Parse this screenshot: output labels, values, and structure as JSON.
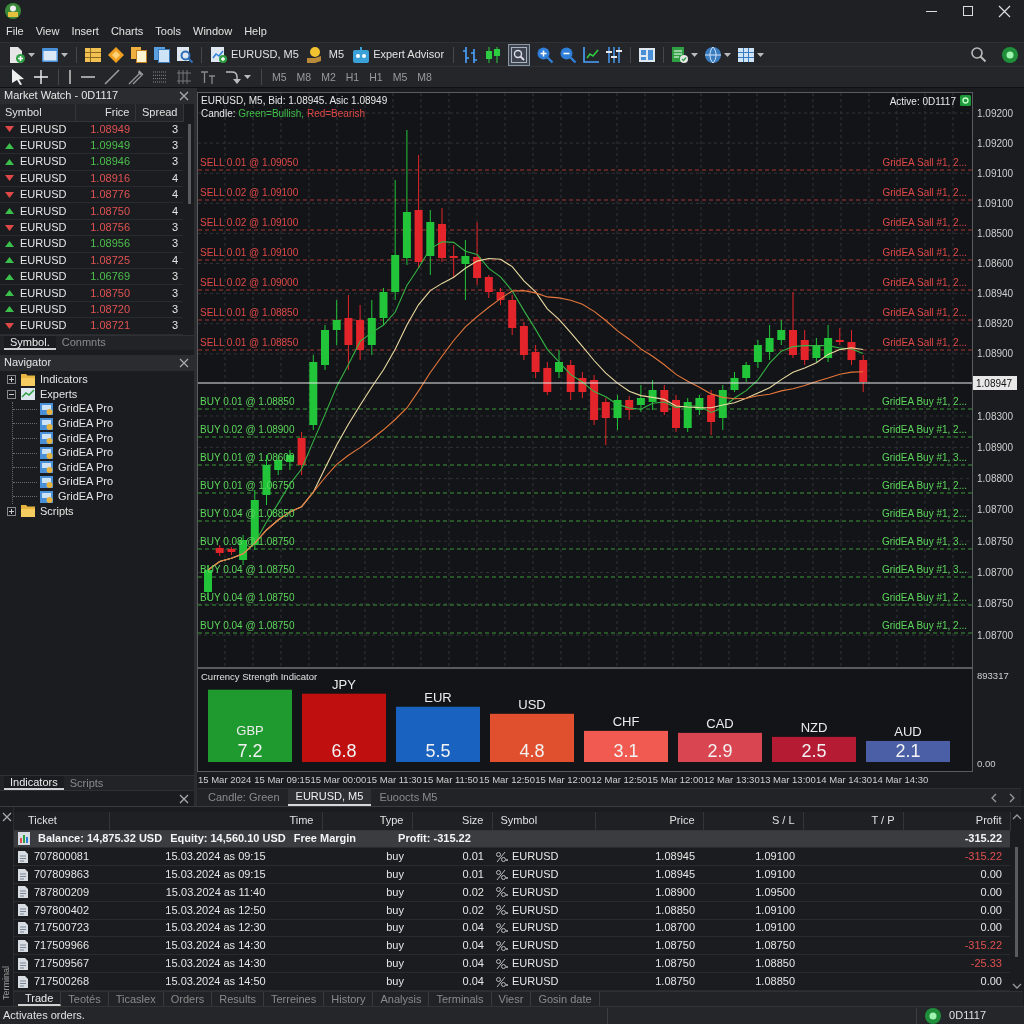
{
  "menu": [
    "File",
    "View",
    "Insert",
    "Charts",
    "Tools",
    "Window",
    "Help"
  ],
  "toolbar": [
    {
      "kind": "icon",
      "dropdown": true,
      "pressed": false
    },
    {
      "kind": "icon",
      "dropdown": true,
      "pressed": false
    },
    {
      "kind": "separator"
    },
    {
      "kind": "icon",
      "dropdown": false,
      "pressed": false
    },
    {
      "kind": "icon",
      "dropdown": false,
      "pressed": false
    },
    {
      "kind": "icon",
      "dropdown": false,
      "pressed": false
    },
    {
      "kind": "icon",
      "dropdown": false,
      "pressed": false
    },
    {
      "kind": "icon",
      "dropdown": false,
      "pressed": false
    },
    {
      "kind": "separator"
    },
    {
      "kind": "labeled",
      "label": "EURUSD, M5",
      "pressed": false
    },
    {
      "kind": "icon",
      "dropdown": false,
      "pressed": false
    },
    {
      "kind": "text",
      "label": "M5",
      "pressed": false
    },
    {
      "kind": "labeled",
      "label": "Expert Advisor",
      "pressed": false
    },
    {
      "kind": "separator"
    },
    {
      "kind": "icon",
      "dropdown": false,
      "pressed": false
    },
    {
      "kind": "icon",
      "dropdown": false,
      "pressed": false
    },
    {
      "kind": "icon",
      "dropdown": false,
      "pressed": true
    },
    {
      "kind": "icon",
      "dropdown": false,
      "pressed": false
    },
    {
      "kind": "icon",
      "dropdown": false,
      "pressed": false
    },
    {
      "kind": "icon",
      "dropdown": false,
      "pressed": false
    },
    {
      "kind": "icon",
      "dropdown": false,
      "pressed": false
    },
    {
      "kind": "separator"
    },
    {
      "kind": "icon",
      "dropdown": false,
      "pressed": false
    },
    {
      "kind": "separator"
    },
    {
      "kind": "icon",
      "dropdown": true,
      "pressed": false
    },
    {
      "kind": "icon",
      "dropdown": true,
      "pressed": false
    },
    {
      "kind": "icon",
      "dropdown": true,
      "pressed": false
    }
  ],
  "drawing_toolbar": [
    {
      "kind": "icon",
      "dropdown": false,
      "pressed": false
    },
    {
      "kind": "icon",
      "dropdown": false,
      "pressed": false
    },
    {
      "kind": "separator"
    },
    {
      "kind": "icon",
      "dropdown": false,
      "pressed": false
    },
    {
      "kind": "icon",
      "dropdown": false,
      "pressed": false
    },
    {
      "kind": "icon",
      "dropdown": false,
      "pressed": false
    },
    {
      "kind": "icon",
      "dropdown": false,
      "pressed": false
    },
    {
      "kind": "icon",
      "dropdown": false,
      "pressed": false
    },
    {
      "kind": "icon",
      "dropdown": false,
      "pressed": false
    },
    {
      "kind": "icon",
      "dropdown": false,
      "pressed": false
    },
    {
      "kind": "icon",
      "dropdown": true,
      "pressed": false
    },
    {
      "kind": "separator"
    },
    {
      "kind": "text",
      "label": "M5",
      "pressed": false
    },
    {
      "kind": "text",
      "label": "M8",
      "pressed": false
    },
    {
      "kind": "text",
      "label": "M2",
      "pressed": false
    },
    {
      "kind": "text",
      "label": "H1",
      "pressed": false
    },
    {
      "kind": "text",
      "label": "H1",
      "pressed": false
    },
    {
      "kind": "text",
      "label": "M5",
      "pressed": false
    },
    {
      "kind": "text",
      "label": "M8",
      "pressed": false
    }
  ],
  "market_watch": {
    "title": "Market Watch - 0D1117",
    "columns": [
      "Symbol",
      "Frice",
      "Spread"
    ],
    "rows": [
      {
        "kind": "down",
        "symbol": "EURUSD",
        "price": "1.08949",
        "color": "#e05252",
        "spread": "3"
      },
      {
        "kind": "up",
        "symbol": "EURUSD",
        "price": "1.09949",
        "color": "#4cbf4c",
        "spread": "3"
      },
      {
        "kind": "up",
        "symbol": "EURUSD",
        "price": "1.08946",
        "color": "#4cbf4c",
        "spread": "3"
      },
      {
        "kind": "down",
        "symbol": "EURUSD",
        "price": "1.08916",
        "color": "#e05252",
        "spread": "4"
      },
      {
        "kind": "down",
        "symbol": "EURUSD",
        "price": "1.08776",
        "color": "#e05252",
        "spread": "4"
      },
      {
        "kind": "up",
        "symbol": "EURUSD",
        "price": "1.08750",
        "color": "#e05252",
        "spread": "4"
      },
      {
        "kind": "down",
        "symbol": "EURUSD",
        "price": "1.08756",
        "color": "#e05252",
        "spread": "3"
      },
      {
        "kind": "up",
        "symbol": "EURUSD",
        "price": "1.08956",
        "color": "#4cbf4c",
        "spread": "3"
      },
      {
        "kind": "up",
        "symbol": "EURUSD",
        "price": "1.08725",
        "color": "#e05252",
        "spread": "4"
      },
      {
        "kind": "up",
        "symbol": "EURUSD",
        "price": "1.06769",
        "color": "#4cbf4c",
        "spread": "3"
      },
      {
        "kind": "up",
        "symbol": "EURUSD",
        "price": "1.08750",
        "color": "#e05252",
        "spread": "3"
      },
      {
        "kind": "up",
        "symbol": "EURUSD",
        "price": "1.08720",
        "color": "#e05252",
        "spread": "3"
      },
      {
        "kind": "down",
        "symbol": "EURUSD",
        "price": "1.08721",
        "color": "#e05252",
        "spread": "3"
      }
    ],
    "tabs": [
      {
        "label": "Symbol.",
        "selected": true
      },
      {
        "label": "Conmnts",
        "selected": false
      }
    ]
  },
  "navigator": {
    "title": "Navigator",
    "tree": [
      {
        "label": "Indicators",
        "kind": "folder",
        "expanded": false
      },
      {
        "label": "Experts",
        "kind": "experts",
        "expanded": true,
        "children": [
          {
            "label": "GridEA Pro"
          },
          {
            "label": "GridEA Pro"
          },
          {
            "label": "GridEA Pro"
          },
          {
            "label": "GridEA Pro"
          },
          {
            "label": "GridEA Pro"
          },
          {
            "label": "GridEA Pro"
          },
          {
            "label": "GridEA Pro"
          }
        ]
      },
      {
        "label": "Scripts",
        "kind": "folder",
        "expanded": false
      }
    ],
    "tabs": [
      {
        "label": "Indicators",
        "selected": true
      },
      {
        "label": "Scripts",
        "selected": false
      }
    ]
  },
  "chart": {
    "info": "EURUSD, M5, Bid: 1.08945. Asic 1.08949",
    "legend": {
      "label": "Candle:",
      "items": [
        {
          "text": "Green=Bullish,",
          "color": "#3fbf4a"
        },
        {
          "text": "Red=Bearish",
          "color": "#e04848"
        }
      ]
    },
    "account": "Active: 0D1117",
    "sell_orders": [
      {
        "label": "SELL 0.01 @ 1.09050",
        "comment": "GridEA Sall #1, 2..."
      },
      {
        "label": "SELL 0.02 @ 1.09100",
        "comment": "GridEA Sall #1, 2..."
      },
      {
        "label": "SELL 0.02 @ 1.09100",
        "comment": "GridEA Sall #1, 2..."
      },
      {
        "label": "SELL 0.01 @ 1.09100",
        "comment": "GridEA Sall #1, 2..."
      },
      {
        "label": "SELL 0.02 @ 1.09000",
        "comment": "GridEA Sall #1, 2..."
      },
      {
        "label": "SELL 0.01 @ 1.08850",
        "comment": "GridEA Sall #1, 2..."
      },
      {
        "label": "SELL 0.01 @ 1.08850",
        "comment": "GridEA Sall #1, 2..."
      }
    ],
    "buy_orders": [
      {
        "label": "BUY 0.01 @ 1.08850",
        "comment": "GridEA Buy #1, 2..."
      },
      {
        "label": "BUY 0.02 @ 1.08900",
        "comment": "GridEA Buy #1, 2..."
      },
      {
        "label": "BUY 0.01 @ 1.08600",
        "comment": "GridEA Buy #1, 3..."
      },
      {
        "label": "BUY 0.01 @ 1.06750",
        "comment": "GridEA Buy #1, 2..."
      },
      {
        "label": "BUY 0.04 @ 1.08850",
        "comment": "GridEA Buy #1, 2..."
      },
      {
        "label": "BUY 0.08 @ 1.08750",
        "comment": "GridEA Buy #1, 3..."
      },
      {
        "label": "BUY 0.04 @ 1.08750",
        "comment": "GridEA Buy #1, 3..."
      },
      {
        "label": "BUY 0.04 @ 1.08750",
        "comment": "GridEA Buy #1, 2..."
      },
      {
        "label": "BUY 0.04 @ 1.08750",
        "comment": "GridEA Buy #1, 2..."
      }
    ],
    "price_axis": [
      "1.09200",
      "1.09200",
      "1.09100",
      "1.09100",
      "1.08500",
      "1.08600",
      "1.08940",
      "1.08920",
      "1.08900",
      "1.08300",
      "1.08900",
      "1.08800",
      "1.08700",
      "1.08750",
      "1.08700",
      "1.08750",
      "1.08700"
    ],
    "current_price": "1.08947",
    "time_axis": [
      "15 Mar 2024",
      "15 Mar 09:15",
      "15 Mar 00:00",
      "15 Mar 11:30",
      "15 Mar 11:50",
      "15 Mar 12:50",
      "15 Mar 12:00",
      "12 Mar 12:50",
      "15 Mar 12:00",
      "12 Mar 13:30",
      "13 Mar 13:00",
      "14 Mar 14:30",
      "14 Mar 14:30"
    ]
  },
  "indicator": {
    "axis": [
      "893317",
      "0.00"
    ],
    "chart_data": {
      "type": "bar",
      "title": "Currency Strength Indicator",
      "categories": [
        "GBP",
        "JPY",
        "EUR",
        "USD",
        "CHF",
        "CAD",
        "NZD",
        "AUD"
      ],
      "values": [
        7.2,
        6.8,
        5.5,
        4.8,
        3.1,
        2.9,
        2.5,
        2.1
      ],
      "data_labels": true
    }
  },
  "chart_tabs": [
    {
      "label": "Candle: Green",
      "selected": false
    },
    {
      "label": "EURUSD, M5",
      "selected": true
    },
    {
      "label": "Euoocts M5",
      "selected": false
    }
  ],
  "terminal": {
    "title": "Terminal",
    "columns": [
      "Ticket",
      "Time",
      "Type",
      "Size",
      "Symbol",
      "Price",
      "S / L",
      "T / P",
      "Profit"
    ],
    "summary": {
      "balance": "Balance: 14,875.32 USD",
      "equity": "Equity: 14,560.10 USD",
      "free_margin": "Free Margin",
      "profit": "Profit: -315.22",
      "total": "-315.22"
    },
    "rows": [
      {
        "ticket": "707800081",
        "time": "15.03.2024 as 09:15",
        "type": "buy",
        "size": "0.01",
        "symbol": "EURUSD",
        "price": "1.08945",
        "sl": "1.09100",
        "profit": "-315.22",
        "loss": true
      },
      {
        "ticket": "707809863",
        "time": "15.03.2024 as 09:15",
        "type": "buy",
        "size": "0.01",
        "symbol": "EURUSD",
        "price": "1.08945",
        "sl": "1.09100",
        "profit": "0.00",
        "loss": false
      },
      {
        "ticket": "787800209",
        "time": "15.03.2024 as 11:40",
        "type": "buy",
        "size": "0.02",
        "symbol": "EURUSD",
        "price": "1.08900",
        "sl": "1.09500",
        "profit": "0.00",
        "loss": false
      },
      {
        "ticket": "797800402",
        "time": "15.03.2024 as 12:50",
        "type": "buy",
        "size": "0.02",
        "symbol": "EURUSD",
        "price": "1.08850",
        "sl": "1.09100",
        "profit": "0.00",
        "loss": false
      },
      {
        "ticket": "717500723",
        "time": "15.03.2024 as 12:30",
        "type": "buy",
        "size": "0.04",
        "symbol": "EURUSD",
        "price": "1.08700",
        "sl": "1.09100",
        "profit": "0.00",
        "loss": false
      },
      {
        "ticket": "717509966",
        "time": "15.03.2024 as 14:30",
        "type": "buy",
        "size": "0.04",
        "symbol": "EURUSD",
        "price": "1.08750",
        "sl": "1.08750",
        "profit": "-315.22",
        "loss": true
      },
      {
        "ticket": "717509567",
        "time": "15.03.2024 as 14:30",
        "type": "buy",
        "size": "0.04",
        "symbol": "EURUSD",
        "price": "1.08750",
        "sl": "1.08850",
        "profit": "-25.33",
        "loss": true
      },
      {
        "ticket": "717500268",
        "time": "15.03.2024 as 14:50",
        "type": "buy",
        "size": "0.04",
        "symbol": "EURUSD",
        "price": "1.08750",
        "sl": "1.08850",
        "profit": "0.00",
        "loss": false
      }
    ],
    "tabs": [
      {
        "label": "Trade",
        "selected": true
      },
      {
        "label": "Teotés",
        "selected": false
      },
      {
        "label": "Ticaslex",
        "selected": false
      },
      {
        "label": "Orders",
        "selected": false
      },
      {
        "label": "Results",
        "selected": false
      },
      {
        "label": "Terreines",
        "selected": false
      },
      {
        "label": "History",
        "selected": false
      },
      {
        "label": "Analysis",
        "selected": false
      },
      {
        "label": "Terminals",
        "selected": false
      },
      {
        "label": "Viesr",
        "selected": false
      },
      {
        "label": "Gosin date",
        "selected": false
      }
    ]
  },
  "status_bar": {
    "message": "Activates orders.",
    "account": "0D1117"
  }
}
